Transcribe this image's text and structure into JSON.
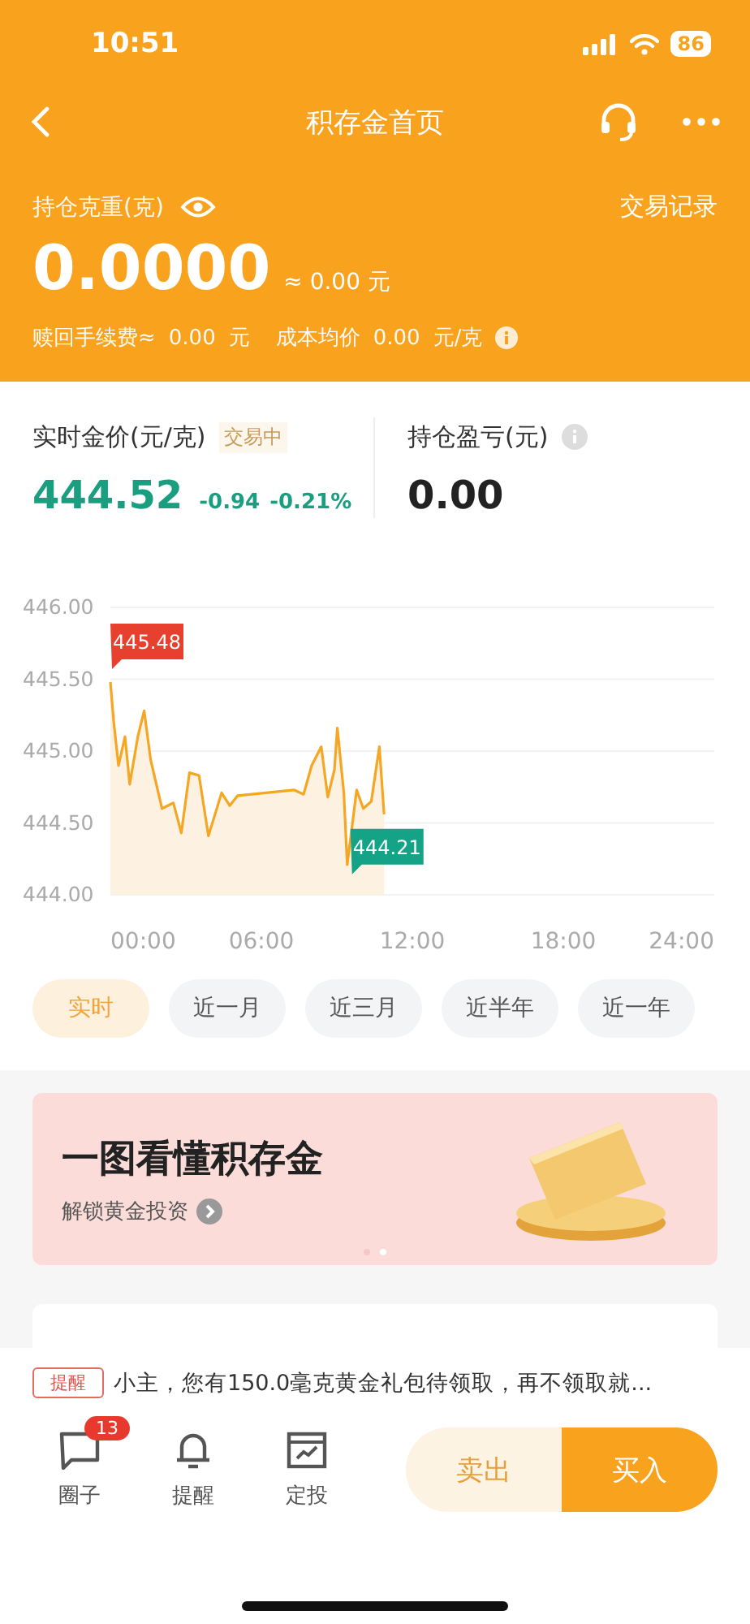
{
  "status_bar": {
    "time": "10:51",
    "battery": "86"
  },
  "nav": {
    "title": "积存金首页"
  },
  "holding": {
    "label": "持仓克重(克)",
    "records_link": "交易记录",
    "grams": "0.0000",
    "approx_value": "≈ 0.00 元",
    "fee_label": "赎回手续费≈",
    "fee_value": "0.00",
    "fee_unit": "元",
    "cost_label": "成本均价",
    "cost_value": "0.00",
    "cost_unit": "元/克"
  },
  "price": {
    "label": "实时金价(元/克)",
    "status": "交易中",
    "value": "444.52",
    "change": "-0.94",
    "change_pct": "-0.21%",
    "pnl_label": "持仓盈亏(元)",
    "pnl_value": "0.00"
  },
  "chart_data": {
    "type": "line",
    "x": [
      0,
      0.13,
      0.32,
      0.58,
      0.77,
      1.09,
      1.34,
      1.6,
      2.05,
      2.5,
      2.82,
      3.14,
      3.52,
      3.9,
      4.42,
      4.74,
      5.06,
      7.3,
      7.68,
      8.0,
      8.38,
      8.64,
      8.9,
      9.02,
      9.28,
      9.41,
      9.79,
      10.05,
      10.37,
      10.69,
      10.88
    ],
    "series": [
      {
        "color": "#f5a623",
        "values": [
          445.48,
          445.21,
          444.9,
          445.1,
          444.77,
          445.1,
          445.28,
          444.94,
          444.6,
          444.64,
          444.43,
          444.85,
          444.83,
          444.41,
          444.71,
          444.62,
          444.69,
          444.73,
          444.7,
          444.9,
          445.03,
          444.68,
          444.87,
          445.16,
          444.71,
          444.21,
          444.73,
          444.6,
          444.65,
          445.03,
          444.56
        ]
      }
    ],
    "xlim": [
      0,
      24
    ],
    "ylim": [
      444,
      446
    ],
    "xticks": [
      {
        "value": 0,
        "label": "00:00"
      },
      {
        "value": 6,
        "label": "06:00"
      },
      {
        "value": 12,
        "label": "12:00"
      },
      {
        "value": 18,
        "label": "18:00"
      },
      {
        "value": 24,
        "label": "24:00"
      }
    ],
    "yticks": [
      {
        "value": 444,
        "label": "444.00"
      },
      {
        "value": 444.5,
        "label": "444.50"
      },
      {
        "value": 445,
        "label": "445.00"
      },
      {
        "value": 445.5,
        "label": "445.50"
      },
      {
        "value": 446,
        "label": "446.00"
      }
    ],
    "grid": true,
    "annotations": [
      {
        "text": "445.48",
        "x": 0,
        "y": 445.48
      },
      {
        "text": "444.21",
        "x": 9.41,
        "y": 444.21
      }
    ]
  },
  "periods": [
    {
      "label": "实时",
      "selected": true
    },
    {
      "label": "近一月",
      "selected": false
    },
    {
      "label": "近三月",
      "selected": false
    },
    {
      "label": "近半年",
      "selected": false
    },
    {
      "label": "近一年",
      "selected": false
    }
  ],
  "banner": {
    "title": "一图看懂积存金",
    "subtitle": "解锁黄金投资",
    "dots": [
      {
        "selected": false
      },
      {
        "selected": true
      }
    ]
  },
  "notice": {
    "tag": "提醒",
    "text": "小主，您有150.0毫克黄金礼包待领取，再不领取就..."
  },
  "tabbar": [
    {
      "kind": "chat",
      "label": "圈子",
      "badge": "13"
    },
    {
      "kind": "bell",
      "label": "提醒"
    },
    {
      "kind": "chart",
      "label": "定投"
    }
  ],
  "actions": {
    "sell": "卖出",
    "buy": "买入"
  }
}
